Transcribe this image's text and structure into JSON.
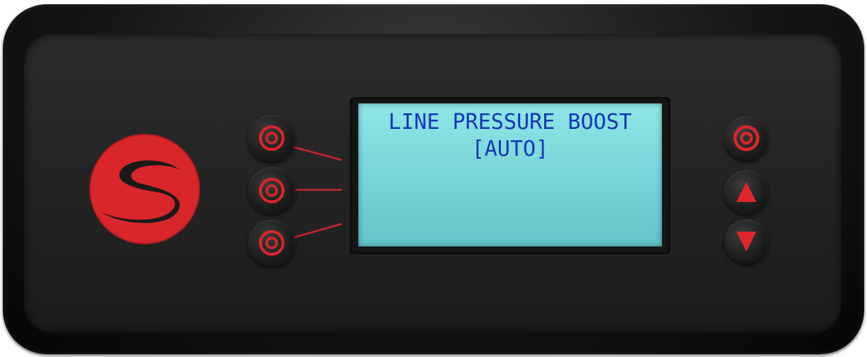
{
  "display": {
    "line1": "LINE PRESSURE BOOST",
    "line2": "[AUTO]"
  },
  "icons": {
    "logo": "brand-s-logo",
    "soft_key": "concentric-ring-icon",
    "enter": "concentric-ring-icon",
    "up": "up-arrow-icon",
    "down": "down-arrow-icon"
  },
  "colors": {
    "accent_red": "#d9262b",
    "lcd_background": "#7fdcdf",
    "lcd_text": "#1636b8",
    "panel": "#262626"
  }
}
